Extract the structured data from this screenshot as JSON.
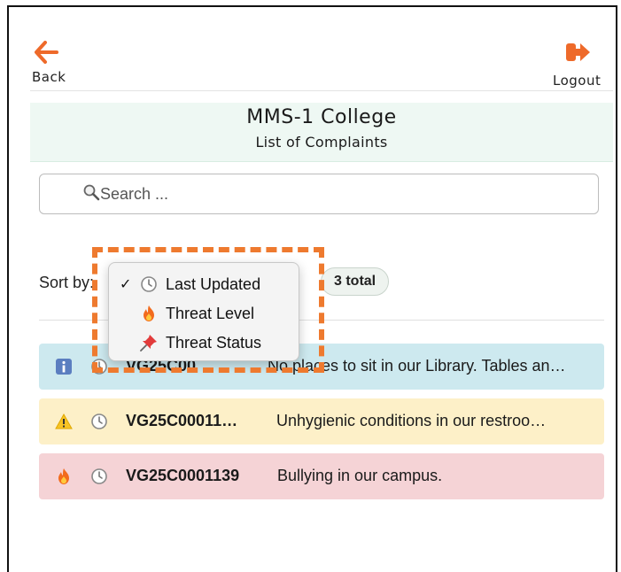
{
  "nav": {
    "back_label": "Back",
    "logout_label": "Logout"
  },
  "header": {
    "college": "MMS-1 College",
    "subtitle": "List of Complaints"
  },
  "search": {
    "placeholder": "Search ...",
    "value": ""
  },
  "sort": {
    "label": "Sort by:",
    "selected": "Last Updated",
    "options": [
      {
        "label": "Last Updated",
        "icon": "clock-icon",
        "checked": true
      },
      {
        "label": "Threat Level",
        "icon": "fire-icon",
        "checked": false
      },
      {
        "label": "Threat Status",
        "icon": "pushpin-icon",
        "checked": false
      }
    ]
  },
  "count_badge": "3 total",
  "complaints": [
    {
      "level": "info",
      "icon": "info-icon",
      "id": "VG25C00",
      "description": "No places to sit in our Library. Tables an…",
      "color": "#cde9ef"
    },
    {
      "level": "warning",
      "icon": "warning-icon",
      "id": "VG25C00011…",
      "description": "Unhygienic conditions in our restroo…",
      "color": "#fdf0c8"
    },
    {
      "level": "danger",
      "icon": "fire-icon",
      "id": "VG25C0001139",
      "description": "Bullying in our campus.",
      "color": "#f5d3d6"
    }
  ],
  "colors": {
    "accent": "#ee6a2a",
    "highlight": "#ee7a2f",
    "header_band": "#eef8f3"
  }
}
